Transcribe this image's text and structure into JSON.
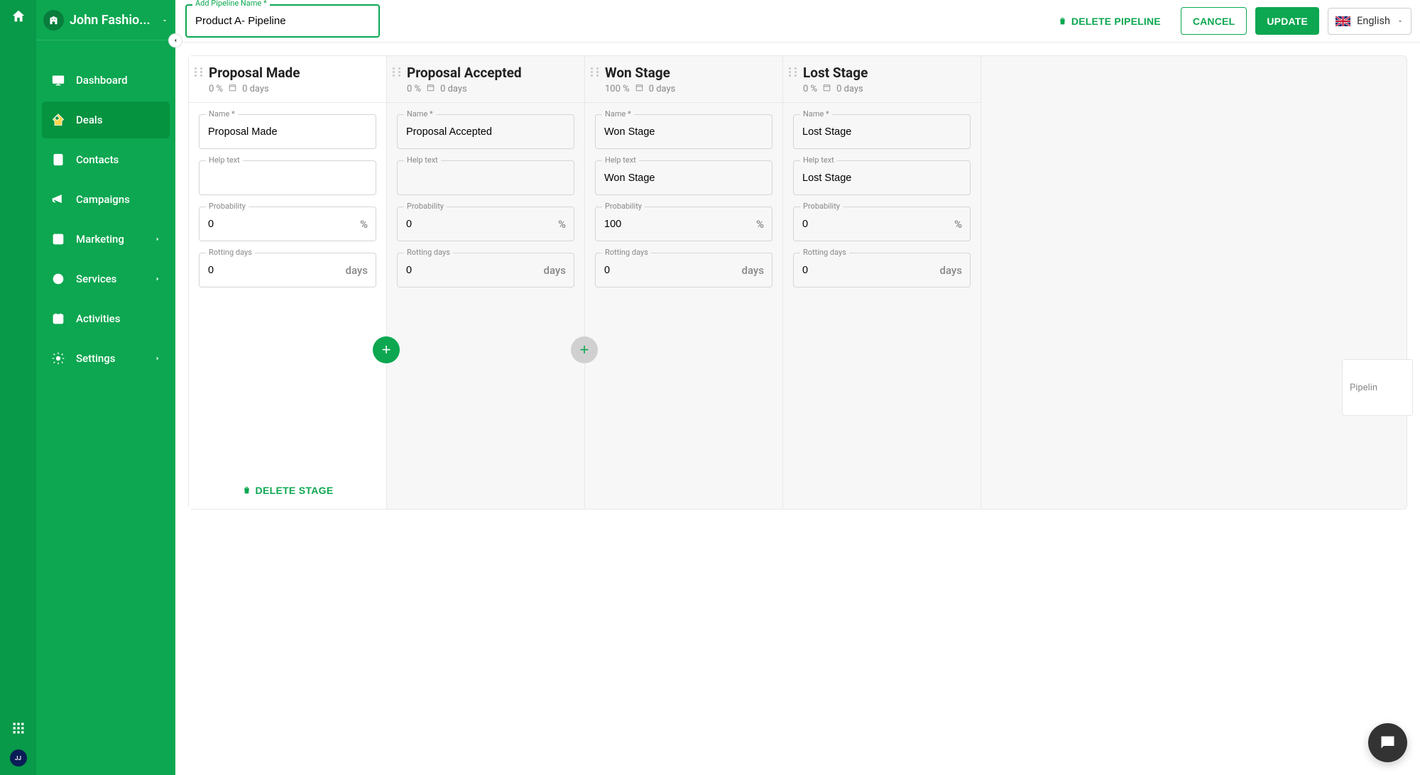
{
  "brand_title": "John Fashio...",
  "language": "English",
  "avatar_initials": "JJ",
  "sidebar": {
    "items": [
      {
        "label": "Dashboard",
        "icon": "dashboard"
      },
      {
        "label": "Deals",
        "icon": "deals",
        "active": true
      },
      {
        "label": "Contacts",
        "icon": "contacts"
      },
      {
        "label": "Campaigns",
        "icon": "campaigns"
      },
      {
        "label": "Marketing",
        "icon": "marketing",
        "expandable": true
      },
      {
        "label": "Services",
        "icon": "services",
        "expandable": true
      },
      {
        "label": "Activities",
        "icon": "activities"
      },
      {
        "label": "Settings",
        "icon": "settings",
        "expandable": true
      }
    ]
  },
  "topbar": {
    "pipeline_name_label": "Add Pipeline Name *",
    "pipeline_name_value": "Product A- Pipeline",
    "delete_pipeline": "DELETE PIPELINE",
    "cancel": "CANCEL",
    "update": "UPDATE"
  },
  "field_labels": {
    "name": "Name *",
    "help_text": "Help text",
    "probability": "Probability",
    "rotting_days": "Rotting days",
    "percent_suffix": "%",
    "days_suffix": "days"
  },
  "delete_stage_label": "DELETE STAGE",
  "stages": [
    {
      "title": "Proposal Made",
      "prob_pct": "0 %",
      "days": "0 days",
      "name": "Proposal Made",
      "help": "",
      "probability": "0",
      "rotting": "0",
      "active": true,
      "fab": "green"
    },
    {
      "title": "Proposal Accepted",
      "prob_pct": "0 %",
      "days": "0 days",
      "name": "Proposal Accepted",
      "help": "",
      "probability": "0",
      "rotting": "0",
      "fab": "grey"
    },
    {
      "title": "Won Stage",
      "prob_pct": "100 %",
      "days": "0 days",
      "name": "Won Stage",
      "help": "Won Stage",
      "probability": "100",
      "rotting": "0"
    },
    {
      "title": "Lost Stage",
      "prob_pct": "0 %",
      "days": "0 days",
      "name": "Lost Stage",
      "help": "Lost Stage",
      "probability": "0",
      "rotting": "0"
    }
  ],
  "ghost_card_text": "Pipelin"
}
